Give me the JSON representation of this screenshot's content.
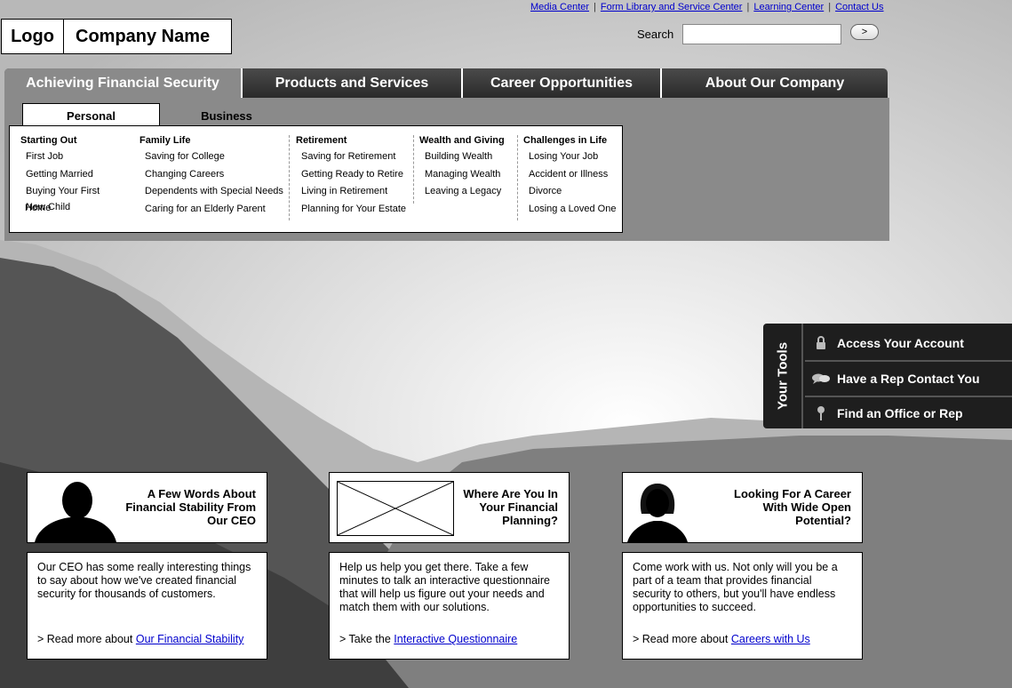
{
  "utility_links": [
    "Media Center",
    "Form Library and Service Center",
    "Learning Center",
    "Contact Us"
  ],
  "logo": {
    "logo_text": "Logo",
    "company_name": "Company Name"
  },
  "search": {
    "label": "Search",
    "value": "",
    "button_label": ">"
  },
  "main_nav": [
    {
      "label": "Achieving Financial Security",
      "active": true
    },
    {
      "label": "Products and Services",
      "active": false
    },
    {
      "label": "Career Opportunities",
      "active": false
    },
    {
      "label": "About Our Company",
      "active": false
    }
  ],
  "subtabs": {
    "active": "Personal",
    "inactive": "Business"
  },
  "menu_columns": [
    {
      "heading": "Starting Out",
      "items": [
        "First Job",
        "Getting Married",
        "Buying Your First",
        "New Child"
      ]
    },
    {
      "heading": "Family Life",
      "items": [
        "Saving for College",
        "Changing Careers",
        "Dependents with Special Needs",
        "Caring for an Elderly Parent"
      ]
    },
    {
      "heading": "Retirement",
      "items": [
        "Saving for Retirement",
        "Getting Ready to Retire",
        "Living in Retirement",
        "Planning for Your Estate"
      ]
    },
    {
      "heading": "Wealth and Giving",
      "items": [
        "Building Wealth",
        "Managing Wealth",
        "Leaving a Legacy"
      ]
    },
    {
      "heading": "Challenges in Life",
      "items": [
        "Losing Your Job",
        "Accident or Illness",
        "Divorce",
        "Losing a Loved One"
      ]
    }
  ],
  "home_label": "Home",
  "tools": {
    "label": "Your Tools",
    "items": [
      {
        "label": "Access Your Account",
        "icon": "lock-icon"
      },
      {
        "label": "Have a Rep Contact You",
        "icon": "chat-bubbles-icon"
      },
      {
        "label": "Find an Office or Rep",
        "icon": "map-pin-icon"
      }
    ]
  },
  "cards": [
    {
      "title_lines": [
        "A Few Words About",
        "Financial Stability From",
        "Our CEO"
      ],
      "image": "male-silhouette-icon",
      "body": "Our CEO has some really interesting things to say about how we've created financial security for thousands of customers.",
      "link_prefix": "> Read more about",
      "link_text": "Our Financial Stability"
    },
    {
      "title_lines": [
        "Where Are You In",
        "Your Financial",
        "Planning?"
      ],
      "image": "image-placeholder-icon",
      "body": "Help us help you get there. Take a few minutes to talk an interactive questionnaire that will help us figure out your needs and match them with our solutions.",
      "link_prefix": "> Take the",
      "link_text": "Interactive Questionnaire"
    },
    {
      "title_lines": [
        "Looking For A Career",
        "With Wide Open",
        "Potential?"
      ],
      "image": "female-silhouette-icon",
      "body": "Come work with us. Not only will you be a part of a team that provides financial security to others, but you'll have endless opportunities to succeed.",
      "link_prefix": "> Read more about",
      "link_text": "Careers with Us"
    }
  ]
}
